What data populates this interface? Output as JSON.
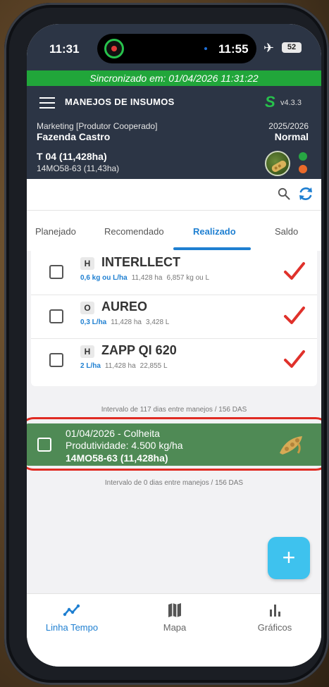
{
  "status_bar": {
    "time": "11:31",
    "island_time": "11:55",
    "battery": "52"
  },
  "sync": {
    "text": "Sincronizado em: 01/04/2026 11:31:22"
  },
  "header": {
    "title": "MANEJOS DE INSUMOS",
    "version": "v4.3.3",
    "company": "Marketing [Produtor Cooperado]",
    "farm": "Fazenda Castro",
    "season": "2025/2026",
    "mode": "Normal",
    "plot": "T 04 (11,428ha)",
    "variety": "14MO58-63 (11,43ha)"
  },
  "tabs": [
    {
      "label": "Planejado"
    },
    {
      "label": "Recomendado"
    },
    {
      "label": "Realizado",
      "active": true
    },
    {
      "label": "Saldo"
    }
  ],
  "products": [
    {
      "type": "H",
      "name": "INTERLLECT",
      "dose": "0,6 kg ou L/ha",
      "area": "11,428 ha",
      "total": "6,857 kg ou L",
      "done": true
    },
    {
      "type": "O",
      "name": "AUREO",
      "dose": "0,3 L/ha",
      "area": "11,428 ha",
      "total": "3,428 L",
      "done": true
    },
    {
      "type": "H",
      "name": "ZAPP QI 620",
      "dose": "2 L/ha",
      "area": "11,428 ha",
      "total": "22,855 L",
      "done": true
    }
  ],
  "interval_1": "Intervalo de 117 dias entre manejos / 156 DAS",
  "harvest": {
    "title": "01/04/2026 - Colheita",
    "productivity": "Produtividade: 4.500 kg/ha",
    "plot": "14MO58-63 (11,428ha)"
  },
  "interval_2": "Intervalo de 0 dias entre manejos / 156 DAS",
  "fab": {
    "label": "+"
  },
  "bottom_nav": [
    {
      "label": "Linha Tempo",
      "icon": "timeline-icon",
      "active": true
    },
    {
      "label": "Mapa",
      "icon": "map-icon"
    },
    {
      "label": "Gráficos",
      "icon": "bar-chart-icon"
    }
  ],
  "colors": {
    "header_bg": "#2c3545",
    "sync_green": "#21a63a",
    "accent_blue": "#1e7fd1",
    "harvest_green": "#4f8a55",
    "check_red": "#e0312b",
    "fab_blue": "#3ec2ee"
  }
}
